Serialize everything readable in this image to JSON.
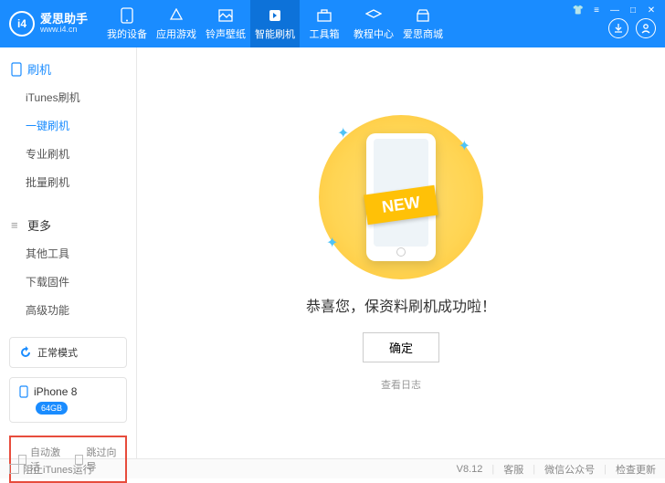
{
  "app": {
    "name": "爱思助手",
    "url": "www.i4.cn"
  },
  "nav": [
    {
      "label": "我的设备"
    },
    {
      "label": "应用游戏"
    },
    {
      "label": "铃声壁纸"
    },
    {
      "label": "智能刷机"
    },
    {
      "label": "工具箱"
    },
    {
      "label": "教程中心"
    },
    {
      "label": "爱思商城"
    }
  ],
  "sidebar": {
    "flash": {
      "title": "刷机",
      "items": [
        "iTunes刷机",
        "一键刷机",
        "专业刷机",
        "批量刷机"
      ]
    },
    "more": {
      "title": "更多",
      "items": [
        "其他工具",
        "下载固件",
        "高级功能"
      ]
    },
    "mode": "正常模式",
    "device": {
      "name": "iPhone 8",
      "storage": "64GB"
    },
    "auto_activate": "自动激活",
    "skip_guide": "跳过向导"
  },
  "main": {
    "ribbon": "NEW",
    "message": "恭喜您，保资料刷机成功啦！",
    "confirm": "确定",
    "log": "查看日志"
  },
  "footer": {
    "block_itunes": "阻止iTunes运行",
    "version": "V8.12",
    "support": "客服",
    "wechat": "微信公众号",
    "check_update": "检查更新"
  }
}
